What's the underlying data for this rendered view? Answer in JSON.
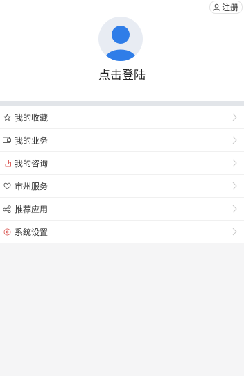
{
  "header": {
    "register_label": "注册",
    "login_prompt": "点击登陆"
  },
  "menu": {
    "items": [
      {
        "label": "我的收藏",
        "icon": "star-icon"
      },
      {
        "label": "我的业务",
        "icon": "business-card-icon"
      },
      {
        "label": "我的咨询",
        "icon": "chat-icon"
      },
      {
        "label": "市州服务",
        "icon": "heart-icon"
      },
      {
        "label": "推荐应用",
        "icon": "share-icon"
      },
      {
        "label": "系统设置",
        "icon": "settings-icon"
      }
    ]
  },
  "colors": {
    "avatar_blue": "#2f7de8",
    "icon_red": "#d9534f",
    "chevron": "#c8c8c8"
  }
}
